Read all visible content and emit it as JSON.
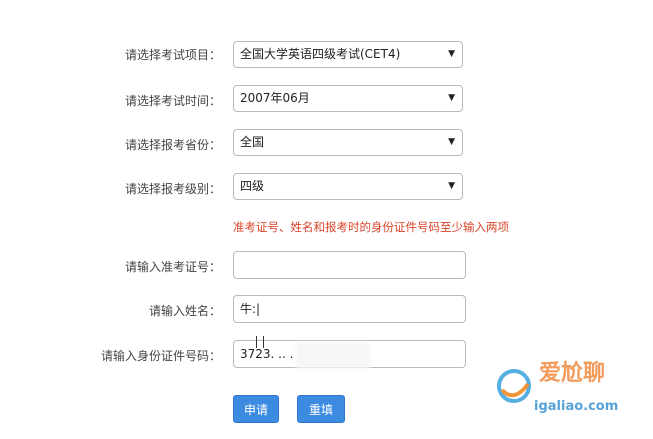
{
  "form": {
    "exam_item": {
      "label": "请选择考试项目：",
      "value": "全国大学英语四级考试(CET4)"
    },
    "exam_time": {
      "label": "请选择考试时间：",
      "value": "2007年06月"
    },
    "province": {
      "label": "请选择报考省份：",
      "value": "全国"
    },
    "level": {
      "label": "请选择报考级别：",
      "value": "四级"
    },
    "notice": "准考证号、姓名和报考时的身份证件号码至少输入两项",
    "ticket_no": {
      "label": "请输入准考证号：",
      "value": ""
    },
    "name": {
      "label": "请输入姓名：",
      "value": "牛:|"
    },
    "id_no": {
      "label": "请输入身份证件号码：",
      "value": "3723. .. ."
    },
    "buttons": {
      "submit": "申请",
      "reset": "重填"
    }
  },
  "watermark": {
    "line1": "爱尬聊",
    "line2": "igaliao.com"
  },
  "colors": {
    "notice": "#d9442b",
    "button": "#3d8be0"
  }
}
